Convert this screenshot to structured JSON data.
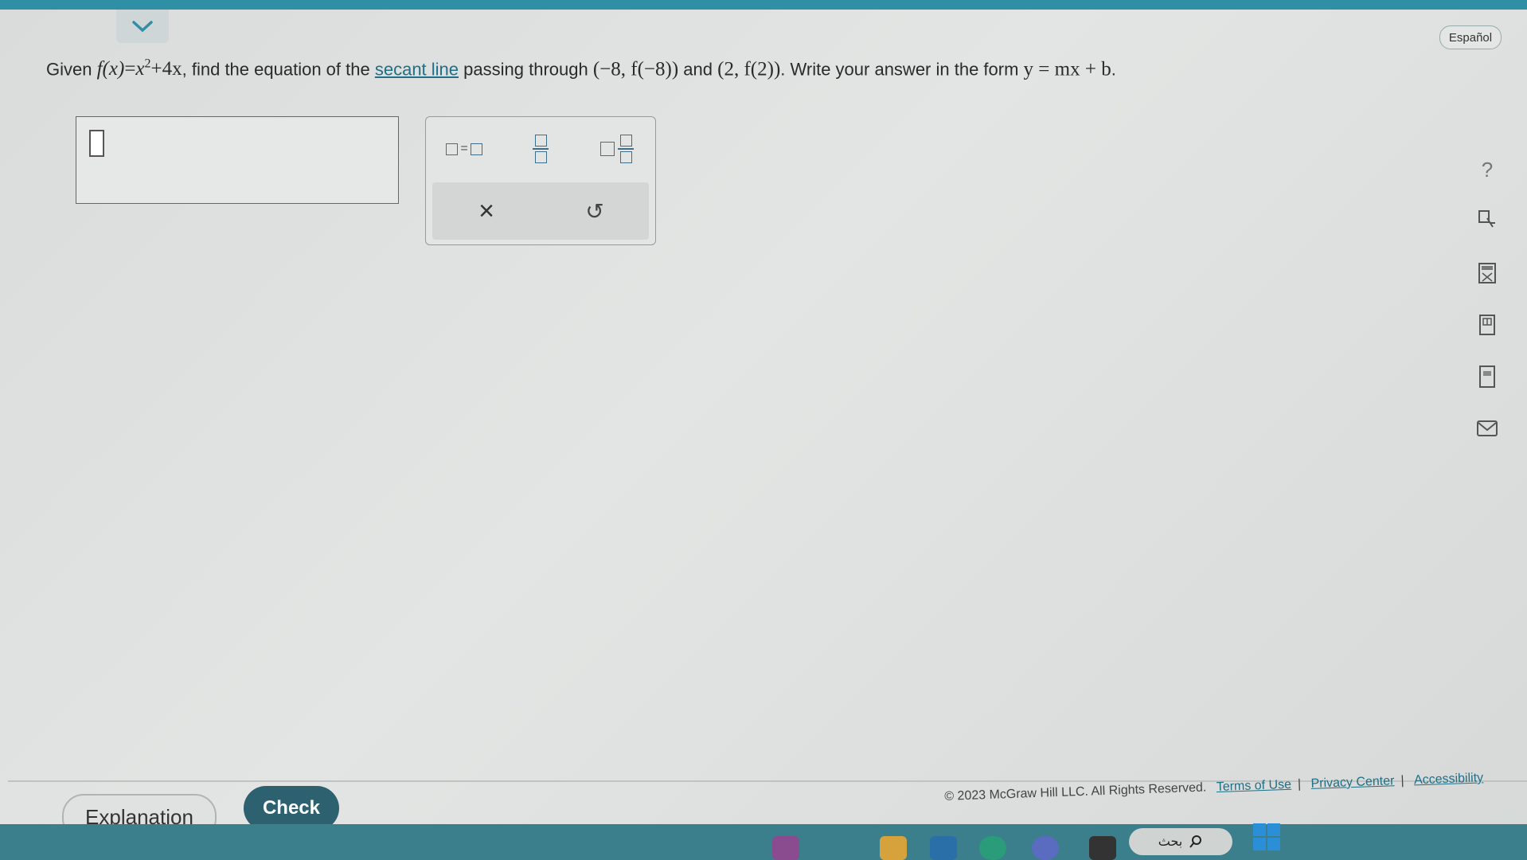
{
  "header": {
    "language_button": "Español"
  },
  "question": {
    "given_label": "Given",
    "function_expr": {
      "lhs": "f(x)",
      "eq": "=",
      "x_base": "x",
      "exponent": "2",
      "rest": "+4x"
    },
    "text1": ", find the equation of the",
    "link_text": "secant line",
    "text2": "passing through",
    "point1": "(−8, f(−8))",
    "text3": "and",
    "point2": "(2, f(2))",
    "text4": ". Write your answer in the form",
    "form_expr": "y = mx + b",
    "end": "."
  },
  "answer_input": {
    "value": ""
  },
  "palette": {
    "equation_icon": "box-equals-box-icon",
    "fraction_icon": "fraction-icon",
    "mixed_number_icon": "mixed-number-icon",
    "clear_symbol": "×",
    "undo_symbol": "↺"
  },
  "sidebar": {
    "icons": [
      "help-icon",
      "dictionary-icon",
      "calculator-icon",
      "textbook-icon",
      "glossary-icon",
      "mail-icon"
    ],
    "help_symbol": "?"
  },
  "footer": {
    "explanation_label": "Explanation",
    "check_label": "Check",
    "copyright": "© 2023 McGraw Hill LLC. All Rights Reserved.",
    "terms_link": "Terms of Use",
    "privacy_link": "Privacy Center",
    "accessibility_link": "Accessibility",
    "separator": "|"
  },
  "taskbar": {
    "search_text": "بحث"
  },
  "colors": {
    "accent": "#2f8fa5",
    "check_button": "#2e6170",
    "link": "#1f6f86"
  }
}
